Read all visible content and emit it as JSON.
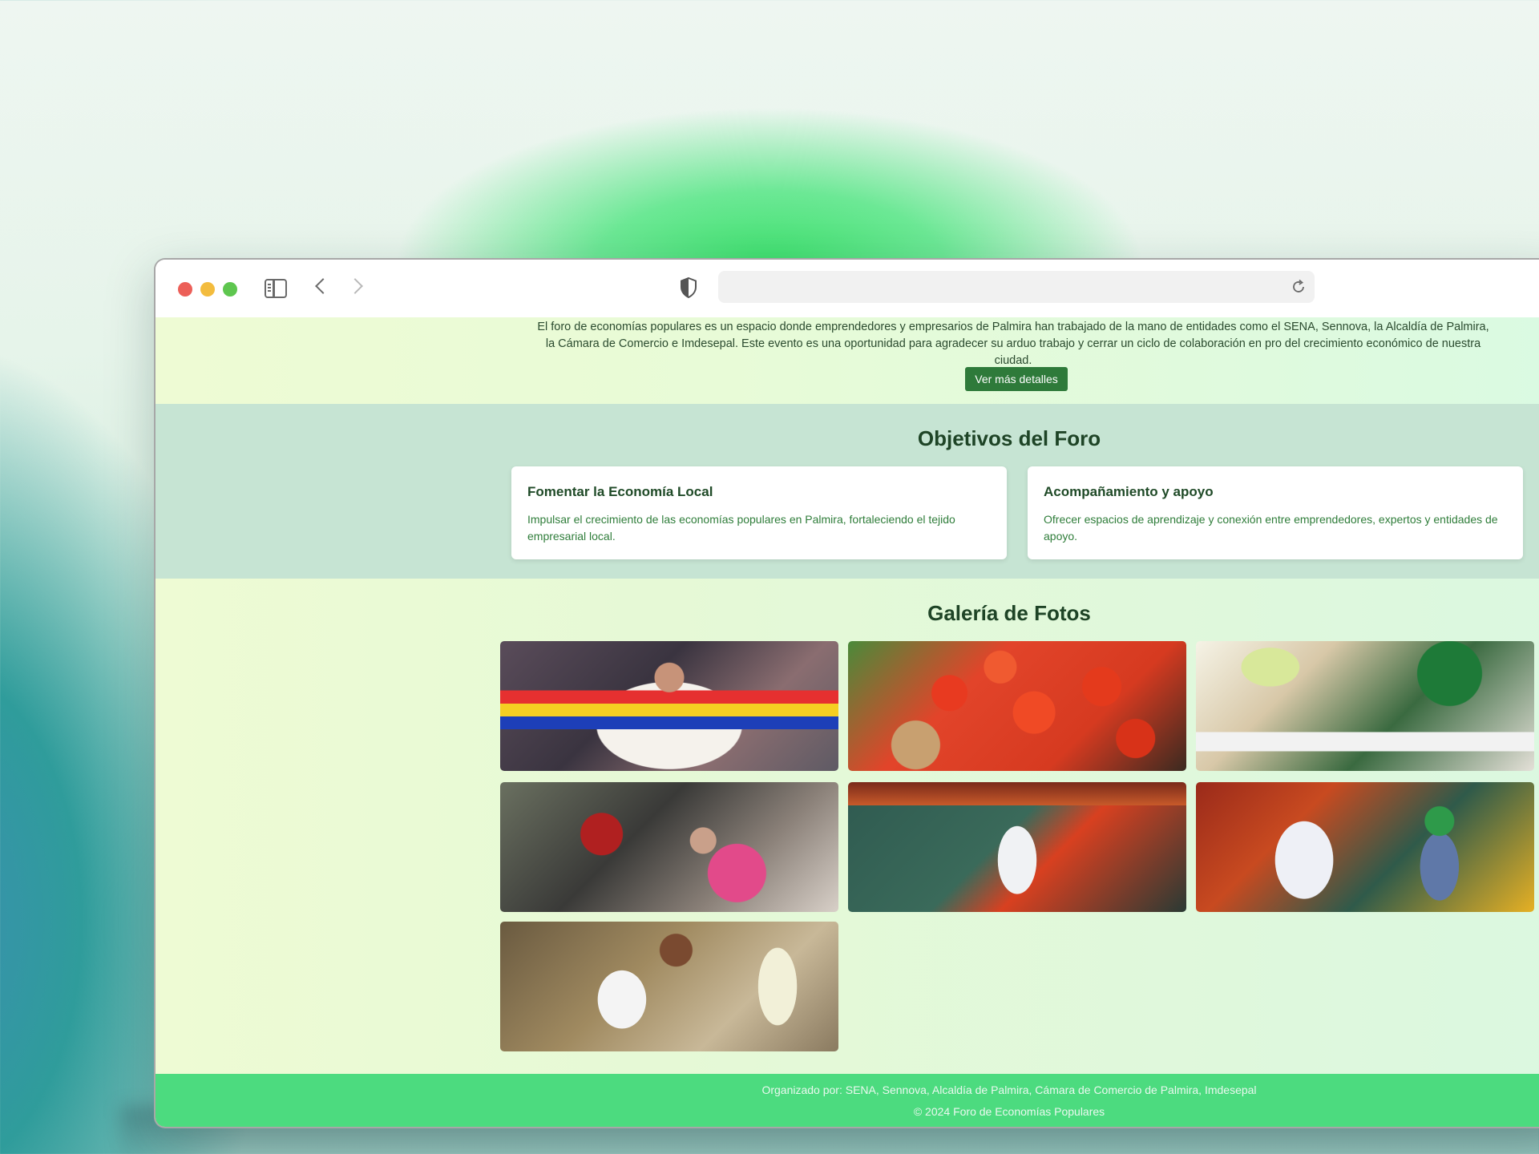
{
  "window": {
    "url": ""
  },
  "intro": {
    "text": "El foro de economías populares es un espacio donde emprendedores y empresarios de Palmira han trabajado de la mano de entidades como el SENA, Sennova, la Alcaldía de Palmira, la Cámara de Comercio e Imdesepal. Este evento es una oportunidad para agradecer su arduo trabajo y cerrar un ciclo de colaboración en pro del crecimiento económico de nuestra ciudad.",
    "button_label": "Ver más detalles"
  },
  "objectives": {
    "title": "Objetivos del Foro",
    "cards": [
      {
        "title": "Fomentar la Economía Local",
        "text": "Impulsar el crecimiento de las economías populares en Palmira, fortaleciendo el tejido empresarial local."
      },
      {
        "title": "Acompañamiento y apoyo",
        "text": "Ofrecer espacios de aprendizaje y conexión entre emprendedores, expertos y entidades de apoyo."
      }
    ]
  },
  "gallery": {
    "title": "Galería de Fotos",
    "photo_count": 7
  },
  "footer": {
    "organizers": "Organizado por: SENA, Sennova, Alcaldía de Palmira, Cámara de Comercio de Palmira, Imdesepal",
    "copyright": "© 2024 Foro de Economías Populares"
  },
  "colors": {
    "accent": "#2e7a3a",
    "footer": "#4cdb7f",
    "objectives_bg": "#c6e4d3"
  }
}
